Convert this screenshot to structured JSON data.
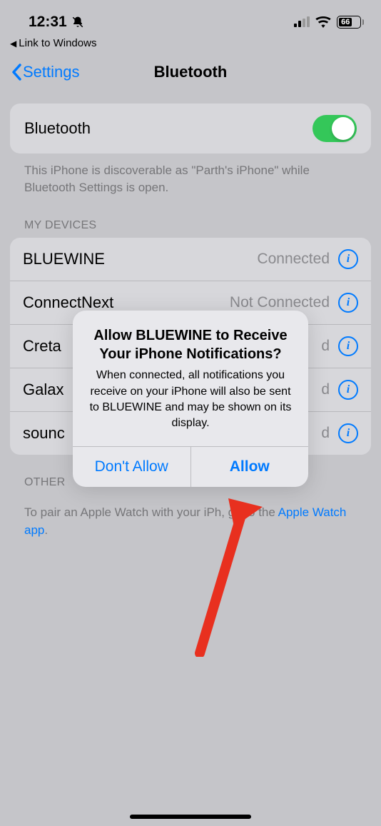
{
  "status": {
    "time": "12:31",
    "battery": "66",
    "breadcrumb": "Link to Windows"
  },
  "nav": {
    "back_label": "Settings",
    "title": "Bluetooth"
  },
  "bluetooth": {
    "label": "Bluetooth",
    "hint": "This iPhone is discoverable as \"Parth's iPhone\" while Bluetooth Settings is open."
  },
  "sections": {
    "my_devices_label": "MY DEVICES",
    "other_label": "OTHER"
  },
  "devices": [
    {
      "name": "BLUEWINE",
      "status": "Connected"
    },
    {
      "name": "ConnectNext",
      "status": "Not Connected"
    },
    {
      "name": "Creta",
      "status": "d"
    },
    {
      "name": "Galax",
      "status": "d"
    },
    {
      "name": "sounc",
      "status": "d"
    }
  ],
  "footer": {
    "text_pre": "To pair an Apple Watch with your iPh",
    "text_mid": ", go to the ",
    "link": "Apple Watch app",
    "period": "."
  },
  "modal": {
    "title": "Allow BLUEWINE to Receive Your iPhone Notifications?",
    "text": "When connected, all notifications you receive on your iPhone will also be sent to BLUEWINE and may be shown on its display.",
    "deny": "Don't Allow",
    "allow": "Allow"
  }
}
